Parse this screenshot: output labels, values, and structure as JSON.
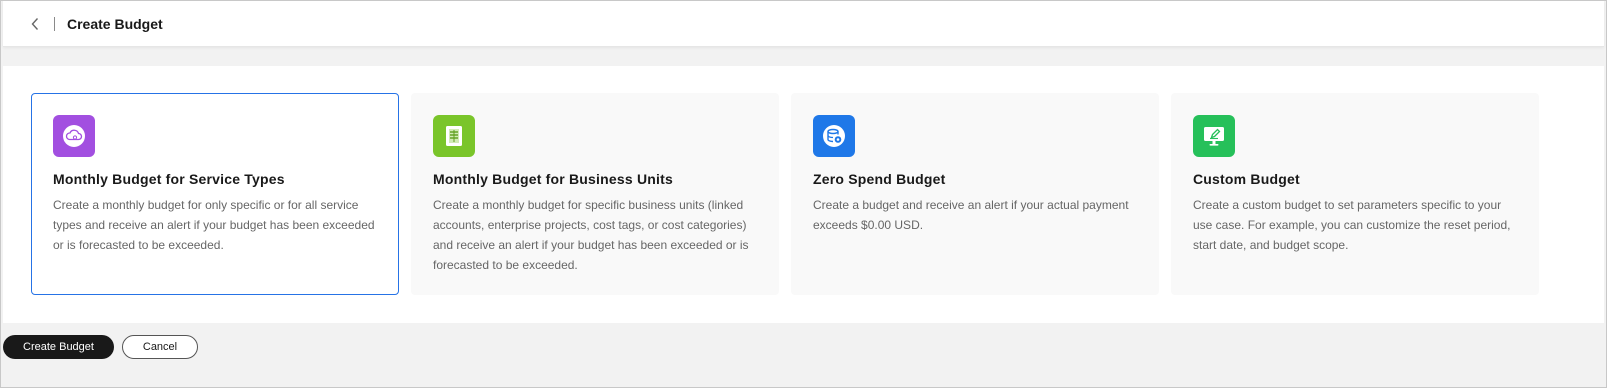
{
  "header": {
    "back_icon": "chevron-left-icon",
    "title": "Create Budget"
  },
  "cards": [
    {
      "title": "Monthly Budget for Service Types",
      "description": "Create a monthly budget for only specific or for all service types and receive an alert if your budget has been exceeded or is forecasted to be exceeded.",
      "icon": "cloud-service-icon",
      "icon_color": "#a24fe0",
      "selected": true
    },
    {
      "title": "Monthly Budget for Business Units",
      "description": "Create a monthly budget for specific business units (linked accounts, enterprise projects, cost tags, or cost categories) and receive an alert if your budget has been exceeded or is forecasted to be exceeded.",
      "icon": "document-list-icon",
      "icon_color": "#7ac52a",
      "selected": false
    },
    {
      "title": "Zero Spend Budget",
      "description": "Create a budget and receive an alert if your actual payment exceeds $0.00 USD.",
      "icon": "coin-stack-icon",
      "icon_color": "#1f78e8",
      "selected": false
    },
    {
      "title": "Custom Budget",
      "description": "Create a custom budget to set parameters specific to your use case. For example, you can customize the reset period, start date, and budget scope.",
      "icon": "monitor-edit-icon",
      "icon_color": "#26c05a",
      "selected": false
    }
  ],
  "footer": {
    "create_label": "Create Budget",
    "cancel_label": "Cancel"
  },
  "colors": {
    "accent": "#2673e6",
    "primary_button": "#191919"
  }
}
